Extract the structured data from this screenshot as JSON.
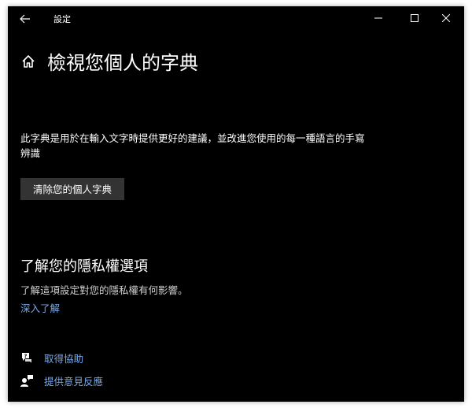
{
  "window": {
    "title": "設定",
    "minimize_label": "Minimize",
    "maximize_label": "Maximize",
    "close_label": "Close",
    "back_label": "Back"
  },
  "header": {
    "title": "檢視您個人的字典",
    "home_icon": "home-icon"
  },
  "main": {
    "description": "此字典是用於在輸入文字時提供更好的建議，並改進您使用的每一種語言的手寫辨識",
    "clear_button_label": "清除您的個人字典"
  },
  "privacy": {
    "heading": "了解您的隱私權選項",
    "description": "了解這項設定對您的隱私權有何影響。",
    "link_label": "深入了解"
  },
  "help": {
    "get_help_label": "取得協助",
    "feedback_label": "提供意見反應"
  },
  "colors": {
    "background": "#000000",
    "text": "#ffffff",
    "link": "#7aa8e6",
    "button": "#333333"
  }
}
